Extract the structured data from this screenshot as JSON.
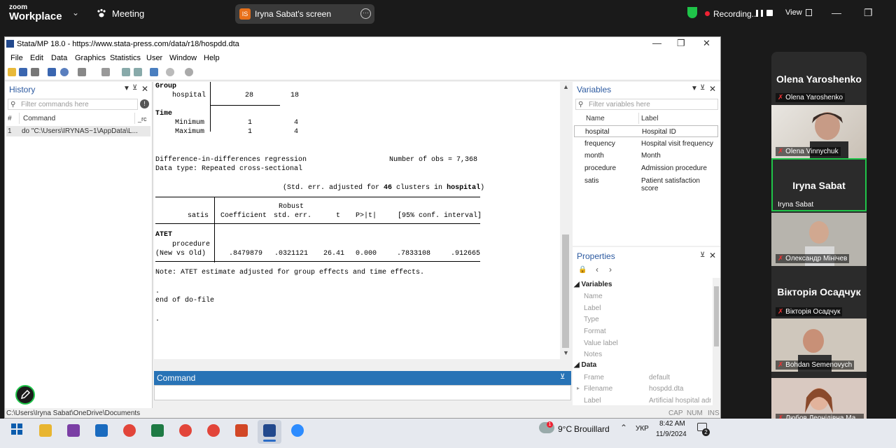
{
  "zoom": {
    "logo_top": "zoom",
    "logo_bottom": "Workplace",
    "meeting_label": "Meeting",
    "share_badge": "IS",
    "share_label": "Iryna Sabat's screen",
    "recording_label": "Recording...",
    "view_label": "View",
    "shield_color": "#1fc449",
    "rec_color": "#e22233"
  },
  "stata": {
    "title": "Stata/MP 18.0 - https://www.stata-press.com/data/r18/hospdd.dta",
    "menu": [
      "File",
      "Edit",
      "Data",
      "Graphics",
      "Statistics",
      "User",
      "Window",
      "Help"
    ],
    "history": {
      "title": "History",
      "filter_placeholder": "Filter commands here",
      "col_num": "#",
      "col_command": "Command",
      "col_rc": "_rc",
      "rows": [
        {
          "num": "1",
          "command": "do \"C:\\Users\\IRYNAS~1\\AppData\\L..."
        }
      ]
    },
    "results": {
      "group_label": "Group",
      "hospital_label": "hospital",
      "hospital_v1": "28",
      "hospital_v2": "18",
      "time_label": "Time",
      "min_label": "Minimum",
      "min_v1": "1",
      "min_v2": "4",
      "max_label": "Maximum",
      "max_v1": "1",
      "max_v2": "4",
      "did_title": "Difference-in-differences regression",
      "nobs": "Number of obs = 7,368",
      "datatype": "Data type: Repeated cross-sectional",
      "stderr_pre": "(Std. err. adjusted for ",
      "stderr_num": "46",
      "stderr_mid": " clusters in ",
      "stderr_var": "hospital",
      "stderr_post": ")",
      "hdr_robust": "Robust",
      "hdr_satis": "satis",
      "hdr_coef": "Coefficient",
      "hdr_se": "std. err.",
      "hdr_t": "t",
      "hdr_p": "P>|t|",
      "hdr_ci": "[95% conf. interval]",
      "atet": "ATET",
      "procedure": "procedure",
      "newvsold": "(New vs Old)",
      "coef": ".8479879",
      "se": ".0321121",
      "t": "26.41",
      "p": "0.000",
      "ci_lo": ".7833108",
      "ci_hi": ".912665",
      "note": "Note: ATET estimate adjusted for group effects and time effects.",
      "dot1": ".",
      "end": "end of do-file",
      "dot2": "."
    },
    "command": {
      "title": "Command"
    },
    "variables": {
      "title": "Variables",
      "filter_placeholder": "Filter variables here",
      "col_name": "Name",
      "col_label": "Label",
      "rows": [
        {
          "name": "hospital",
          "label": "Hospital ID"
        },
        {
          "name": "frequency",
          "label": "Hospital visit frequency"
        },
        {
          "name": "month",
          "label": "Month"
        },
        {
          "name": "procedure",
          "label": "Admission procedure"
        },
        {
          "name": "satis",
          "label": "Patient satisfaction score"
        }
      ]
    },
    "properties": {
      "title": "Properties",
      "sec_variables": "Variables",
      "var_rows": [
        "Name",
        "Label",
        "Type",
        "Format",
        "Value label",
        "Notes"
      ],
      "sec_data": "Data",
      "data_rows": [
        {
          "k": "Frame",
          "v": "default"
        },
        {
          "k": "Filename",
          "v": "hospdd.dta"
        },
        {
          "k": "Label",
          "v": "Artificial hospital adm"
        }
      ]
    },
    "status": {
      "path": "C:\\Users\\Iryna Sabat\\OneDrive\\Documents",
      "caps": "CAP",
      "num": "NUM",
      "ins": "INS"
    }
  },
  "gallery": {
    "p1_name": "Olena Yaroshenko",
    "p1_sub": "Olena Yaroshenko",
    "p2_sub": "Olena Vinnychuk",
    "p3_name": "Iryna Sabat",
    "p3_sub": "Iryna Sabat",
    "p4_sub": "Олександр Мінічев",
    "p5_name": "Вікторія  Осадчук",
    "p5_sub": "Вікторія Осадчук",
    "p6_sub": "Bohdan Semenovych",
    "p7_sub": "Любов Леонідівна Ма..."
  },
  "taskbar": {
    "weather_temp": "9°C",
    "weather_text": "Brouillard",
    "lang": "УКР",
    "time": "8:42 AM",
    "date": "11/9/2024",
    "notif_count": "2",
    "weather_badge": "1"
  }
}
